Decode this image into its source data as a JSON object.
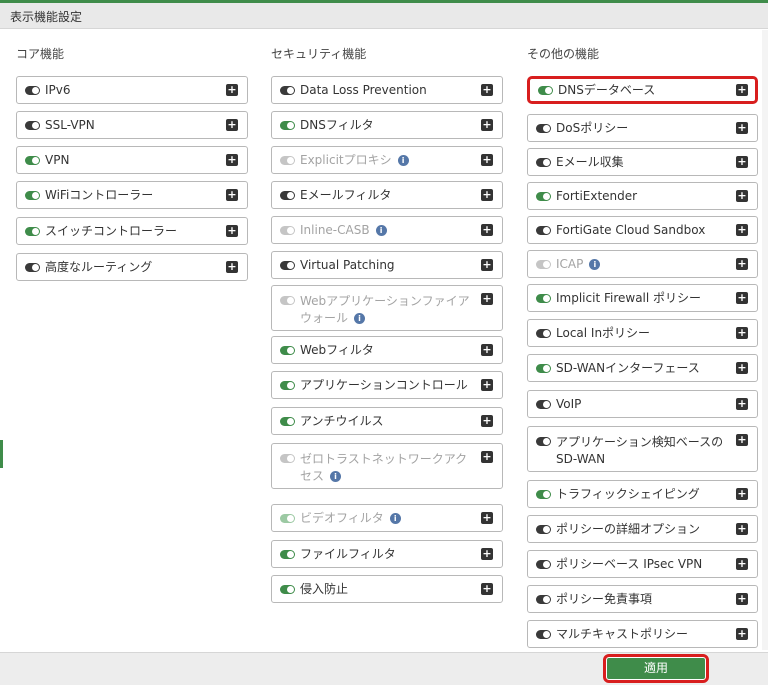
{
  "header": {
    "title": "表示機能設定"
  },
  "columns": [
    {
      "heading": "コア機能",
      "items": [
        {
          "label": "IPv6",
          "state": "off"
        },
        {
          "label": "SSL-VPN",
          "state": "off"
        },
        {
          "label": "VPN",
          "state": "on"
        },
        {
          "label": "WiFiコントローラー",
          "state": "on"
        },
        {
          "label": "スイッチコントローラー",
          "state": "on"
        },
        {
          "label": "高度なルーティング",
          "state": "off"
        }
      ]
    },
    {
      "heading": "セキュリティ機能",
      "items": [
        {
          "label": "Data Loss Prevention",
          "state": "off"
        },
        {
          "label": "DNSフィルタ",
          "state": "on"
        },
        {
          "label": "Explicitプロキシ",
          "state": "disabled",
          "info": true
        },
        {
          "label": "Eメールフィルタ",
          "state": "off"
        },
        {
          "label": "Inline-CASB",
          "state": "disabled",
          "info": true
        },
        {
          "label": "Virtual Patching",
          "state": "off"
        },
        {
          "label": "Webアプリケーションファイアウォール",
          "state": "disabled",
          "info": true
        },
        {
          "label": "Webフィルタ",
          "state": "on"
        },
        {
          "label": "アプリケーションコントロール",
          "state": "on"
        },
        {
          "label": "アンチウイルス",
          "state": "on"
        },
        {
          "label": "ゼロトラストネットワークアクセス",
          "state": "disabled",
          "info": true
        },
        {
          "label": "ビデオフィルタ",
          "state": "disabled-on",
          "info": true
        },
        {
          "label": "ファイルフィルタ",
          "state": "on"
        },
        {
          "label": "侵入防止",
          "state": "on"
        }
      ]
    },
    {
      "heading": "その他の機能",
      "items": [
        {
          "label": "DNSデータベース",
          "state": "on",
          "highlighted": true
        },
        {
          "label": "DoSポリシー",
          "state": "off"
        },
        {
          "label": "Eメール収集",
          "state": "off"
        },
        {
          "label": "FortiExtender",
          "state": "on"
        },
        {
          "label": "FortiGate Cloud Sandbox",
          "state": "off"
        },
        {
          "label": "ICAP",
          "state": "disabled",
          "info": true
        },
        {
          "label": "Implicit Firewall ポリシー",
          "state": "on"
        },
        {
          "label": "Local Inポリシー",
          "state": "off"
        },
        {
          "label": "SD-WANインターフェース",
          "state": "on"
        },
        {
          "label": "VoIP",
          "state": "off"
        },
        {
          "label": "アプリケーション検知ベースのSD-WAN",
          "state": "off"
        },
        {
          "label": "トラフィックシェイピング",
          "state": "on"
        },
        {
          "label": "ポリシーの詳細オプション",
          "state": "off"
        },
        {
          "label": "ポリシーベース IPsec VPN",
          "state": "off"
        },
        {
          "label": "ポリシー免責事項",
          "state": "off"
        },
        {
          "label": "マルチキャストポリシー",
          "state": "off"
        }
      ]
    }
  ],
  "footer": {
    "apply_label": "適用"
  },
  "colors": {
    "accent": "#3f8c4a",
    "highlight": "#d81e1e",
    "info": "#5577a8"
  },
  "icons": {
    "toggle": "toggle-switch-icon",
    "expand": "plus-square-icon",
    "info": "info-circle-icon"
  }
}
